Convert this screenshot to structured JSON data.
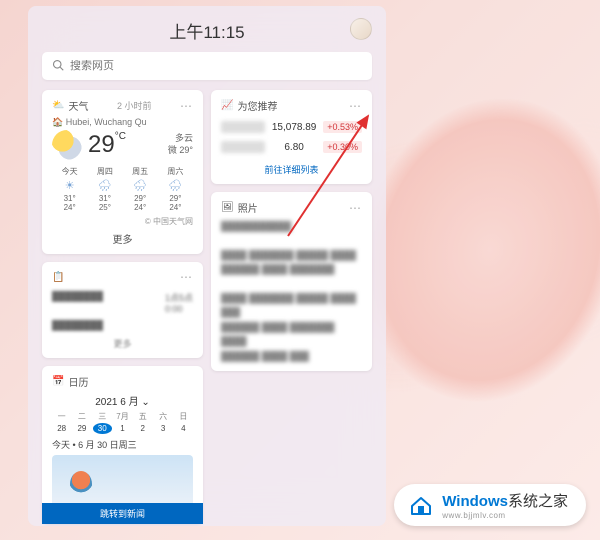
{
  "header": {
    "time": "上午11:15"
  },
  "search": {
    "placeholder": "搜索网页"
  },
  "weather": {
    "title": "天气",
    "meta": "2 小时前",
    "location": "Hubei, Wuchang Qu",
    "temp": "29",
    "unit": "°C",
    "condition": "多云",
    "feels": "微 29°",
    "forecast": [
      {
        "day": "今天",
        "hi": "31°",
        "lo": "24°"
      },
      {
        "day": "周四",
        "hi": "31°",
        "lo": "25°"
      },
      {
        "day": "周五",
        "hi": "29°",
        "lo": "24°"
      },
      {
        "day": "周六",
        "hi": "29°",
        "lo": "24°"
      }
    ],
    "source": "© 中国天气网",
    "more": "更多"
  },
  "todo": {
    "title": "待办",
    "footer": "更多"
  },
  "calendar": {
    "title": "日历",
    "month": "2021 6 月",
    "weekdays": [
      "一",
      "二",
      "三",
      "7月",
      "五",
      "六",
      "日"
    ],
    "days": [
      "28",
      "29",
      "30",
      "1",
      "2",
      "3",
      "4"
    ],
    "selected": "30",
    "today": "今天 • 6 月 30 日周三",
    "button": "跳转到新闻"
  },
  "stocks": {
    "title": "为您推荐",
    "rows": [
      {
        "value": "15,078.89",
        "change": "+0.53%"
      },
      {
        "value": "6.80",
        "change": "+0.30%"
      }
    ],
    "link": "前往详细列表"
  },
  "photos": {
    "title": "照片"
  },
  "watermark": {
    "brand": "Windows",
    "suffix": "系统之家",
    "url": "www.bjjmlv.com"
  }
}
